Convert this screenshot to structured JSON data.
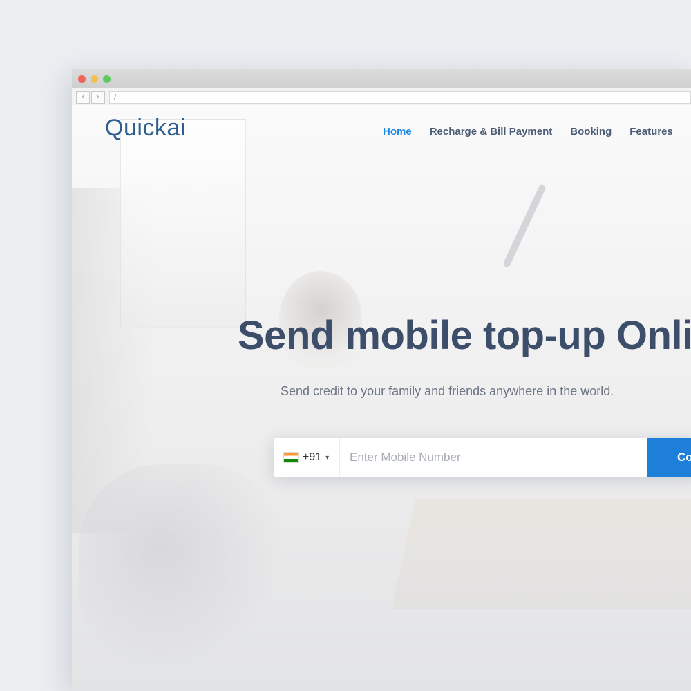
{
  "browser": {
    "back_glyph": "‹",
    "forward_glyph": "›",
    "url": "/"
  },
  "header": {
    "logo": "Quickai",
    "nav": [
      {
        "label": "Home",
        "active": true
      },
      {
        "label": "Recharge & Bill Payment",
        "active": false
      },
      {
        "label": "Booking",
        "active": false
      },
      {
        "label": "Features",
        "active": false
      }
    ]
  },
  "hero": {
    "title": "Send mobile top-up Online",
    "subtitle": "Send credit to your family and friends anywhere in the world."
  },
  "topup_form": {
    "country_code": "+91",
    "country_flag": "india-flag-icon",
    "chevron": "▾",
    "phone_placeholder": "Enter Mobile Number",
    "submit_label": "Continue"
  },
  "colors": {
    "accent": "#1e7fd8",
    "heading": "#3d4e6b",
    "logo": "#2f5f8f"
  }
}
